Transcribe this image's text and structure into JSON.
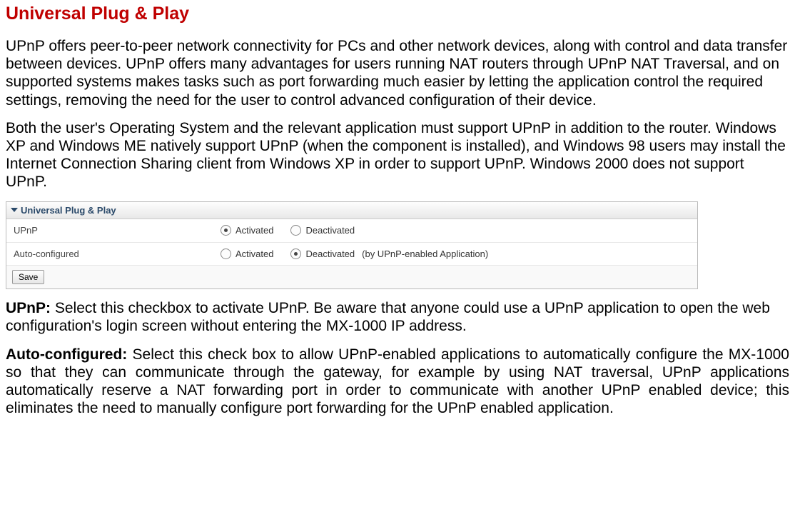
{
  "title": "Universal Plug & Play",
  "paragraphs": {
    "p1": "UPnP offers peer-to-peer network connectivity for PCs and other network devices, along with control and data transfer between devices. UPnP offers many advantages for users running NAT routers through UPnP NAT Traversal, and on supported systems makes tasks such as port forwarding much easier by letting the application control the required settings, removing the need for the user to control advanced configuration of their device.",
    "p2": "Both the user's Operating System and the relevant application must support UPnP in addition to the router. Windows XP and Windows ME natively support UPnP (when the component is installed), and Windows 98 users may install the Internet Connection Sharing client from Windows XP in order to support UPnP. Windows 2000 does not support UPnP.",
    "p3_bold": "UPnP: ",
    "p3_rest": "Select this checkbox to activate UPnP. Be aware that anyone could use a UPnP application to open the web configuration's login screen without entering the MX-1000 IP address.",
    "p4_bold": "Auto-configured: ",
    "p4_rest": "Select this check box to allow UPnP-enabled applications to automatically configure the MX-1000 so that they can communicate through the gateway, for example by using NAT traversal, UPnP applications automatically reserve a NAT forwarding port in order to communicate with another UPnP enabled device; this eliminates the need to manually configure port forwarding for the UPnP enabled application."
  },
  "panel": {
    "header": "Universal Plug & Play",
    "rows": {
      "r1_label": "UPnP",
      "r1_opt1": "Activated",
      "r1_opt2": "Deactivated",
      "r2_label": "Auto-configured",
      "r2_opt1": "Activated",
      "r2_opt2": "Deactivated",
      "r2_suffix": "(by UPnP-enabled Application)"
    },
    "save": "Save"
  }
}
